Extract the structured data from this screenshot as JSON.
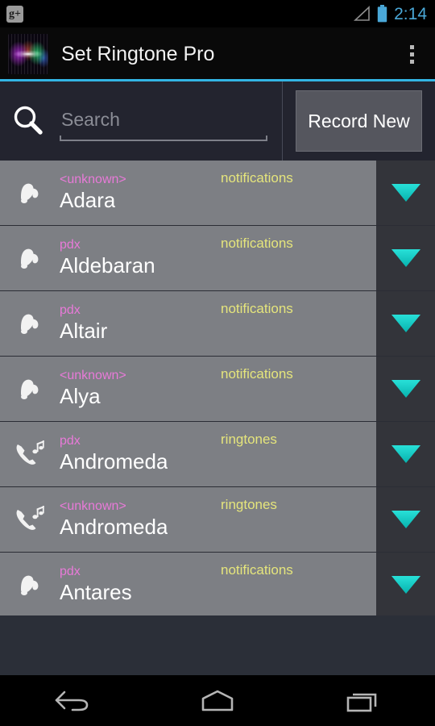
{
  "statusbar": {
    "notification_icon": "google-plus-icon",
    "notification_label": "g+",
    "signal_icon": "signal-triangle-icon",
    "battery_icon": "battery-icon",
    "clock": "2:14"
  },
  "actionbar": {
    "logo_icon": "app-logo-waveform-icon",
    "title": "Set Ringtone Pro",
    "overflow_icon": "overflow-menu-icon"
  },
  "search": {
    "icon": "search-icon",
    "value": "",
    "placeholder": "Search"
  },
  "record": {
    "label": "Record New"
  },
  "list": {
    "dropdown_icon": "caret-down-icon",
    "rows": [
      {
        "artist": "<unknown>",
        "title": "Adara",
        "category": "notifications",
        "icon": "bell-icon"
      },
      {
        "artist": "pdx",
        "title": "Aldebaran",
        "category": "notifications",
        "icon": "bell-icon"
      },
      {
        "artist": "pdx",
        "title": "Altair",
        "category": "notifications",
        "icon": "bell-icon"
      },
      {
        "artist": "<unknown>",
        "title": "Alya",
        "category": "notifications",
        "icon": "bell-icon"
      },
      {
        "artist": "pdx",
        "title": "Andromeda",
        "category": "ringtones",
        "icon": "phone-music-icon"
      },
      {
        "artist": "<unknown>",
        "title": "Andromeda",
        "category": "ringtones",
        "icon": "phone-music-icon"
      },
      {
        "artist": "pdx",
        "title": "Antares",
        "category": "notifications",
        "icon": "bell-icon"
      }
    ]
  },
  "navbar": {
    "back_icon": "back-arrow-icon",
    "home_icon": "home-icon",
    "recents_icon": "recent-apps-icon"
  },
  "colors": {
    "accent": "#33b5e5",
    "caret": "#1ad6cf",
    "artist": "#e87ad8",
    "category": "#e5e57c",
    "row_bg": "#7d7f84",
    "chrome_bg": "#23242f"
  }
}
